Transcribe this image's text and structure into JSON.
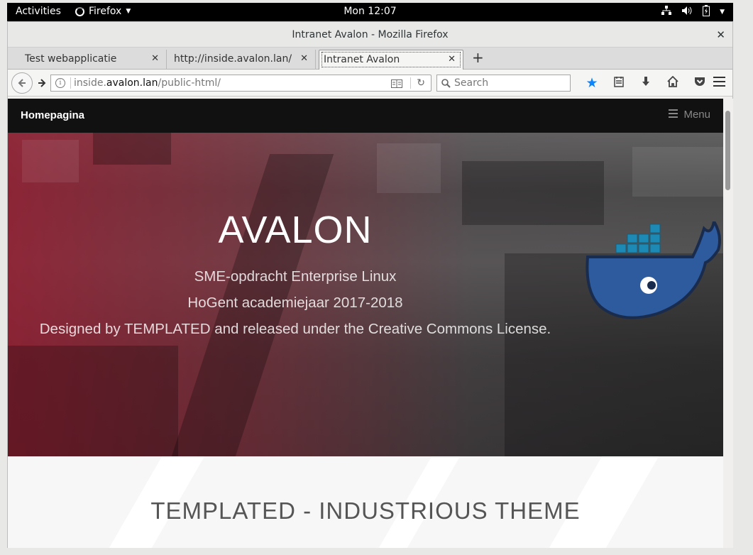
{
  "topbar": {
    "activities": "Activities",
    "app_name": "Firefox",
    "clock": "Mon 12:07",
    "tray_icons": [
      "network-icon",
      "volume-icon",
      "battery-icon",
      "system-menu-caret-icon"
    ]
  },
  "window": {
    "title": "Intranet Avalon - Mozilla Firefox"
  },
  "tabs": [
    {
      "label": "Test webapplicatie",
      "active": false
    },
    {
      "label": "http://inside.avalon.lan/",
      "active": false
    },
    {
      "label": "Intranet Avalon",
      "active": true
    }
  ],
  "navbar": {
    "url_prefix": "inside.",
    "url_host": "avalon.lan",
    "url_path": "/public-html/",
    "search_placeholder": "Search",
    "bookmark_star_color": "#0a84ff",
    "icons": [
      "bookmark-star-icon",
      "reading-list-icon",
      "downloads-icon",
      "home-icon",
      "pocket-icon",
      "menu-icon"
    ]
  },
  "site": {
    "brand": "Homepagina",
    "menu_label": "Menu",
    "hero": {
      "title": "AVALON",
      "line1": "SME-opdracht Enterprise Linux",
      "line2": "HoGent academiejaar 2017-2018",
      "line3": "Designed by TEMPLATED and released under the Creative Commons License.",
      "overlay_color": "#961e32"
    },
    "section_heading": "TEMPLATED - INDUSTRIOUS THEME"
  }
}
